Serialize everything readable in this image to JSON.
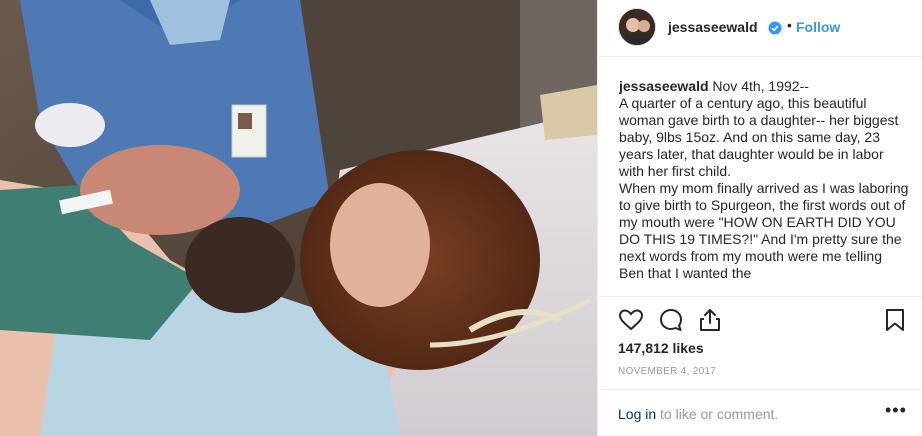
{
  "post": {
    "username": "jessaseewald",
    "follow_label": "Follow",
    "dot": "•"
  },
  "caption": {
    "username": "jessaseewald",
    "lines": [
      "Nov 4th, 1992--",
      "A quarter of a century ago, this beautiful woman gave birth to a daughter-- her biggest baby, 9lbs 15oz. And on this same day, 23 years later, that daughter would be in labor with her first child.",
      "When my mom finally arrived as I was laboring to give birth to Spurgeon, the first words out of my mouth were \"HOW ON EARTH DID YOU DO THIS 19 TIMES?!\" And I'm pretty sure the next words from my mouth were me telling Ben that I wanted the"
    ]
  },
  "actions": {
    "icons": [
      "heart-icon",
      "comment-icon",
      "share-icon",
      "bookmark-icon"
    ]
  },
  "likes_text": "147,812 likes",
  "date_text": "NOVEMBER 4, 2017",
  "footer": {
    "login_label": "Log in",
    "rest_text": " to like or comment.",
    "more_label": "•••"
  },
  "colors": {
    "accent": "#3897f0",
    "link_dark": "#003569",
    "muted": "#999999",
    "text": "#262626"
  }
}
